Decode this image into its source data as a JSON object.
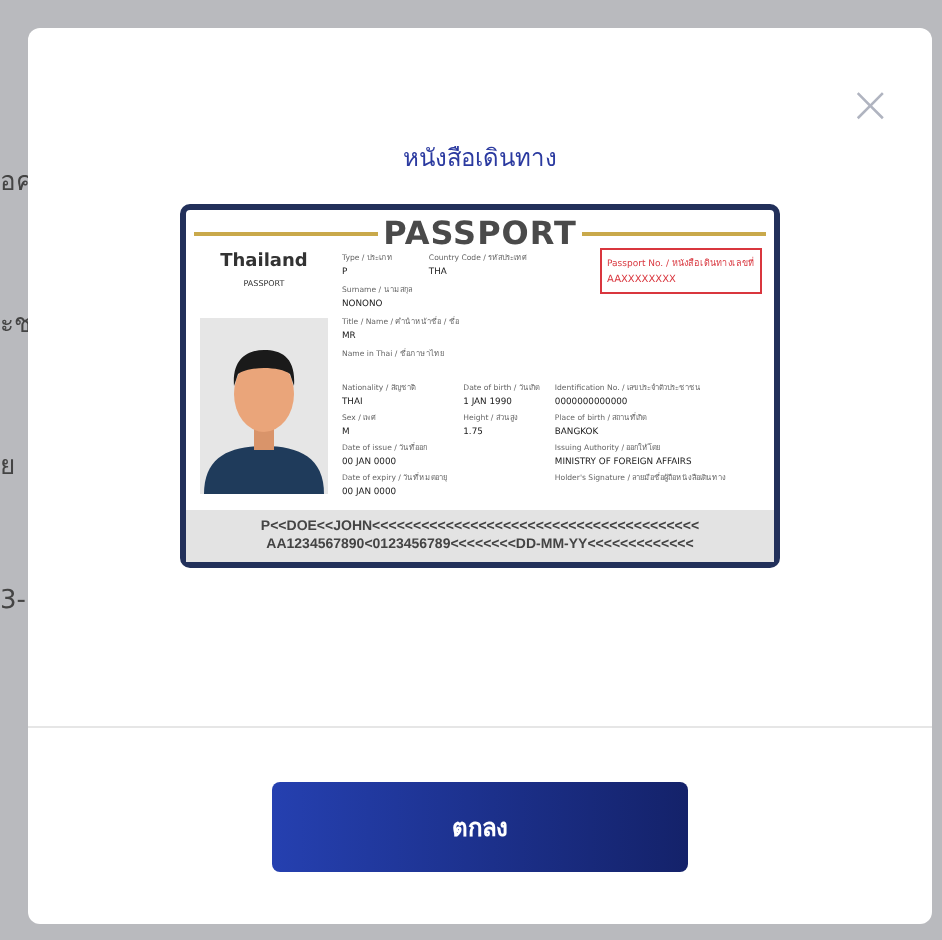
{
  "background": {
    "fragments": [
      "อค",
      "ะช",
      "ย",
      "3-"
    ]
  },
  "dialog": {
    "title": "หนังสือเดินทาง",
    "close": "×",
    "passport": {
      "heading": "PASSPORT",
      "country": "Thailand",
      "subheading": "PASSPORT",
      "number_label": "Passport No. / หนังสือเดินทางเลขที่",
      "number": "AAXXXXXXXX",
      "top_fields": [
        [
          {
            "label": "Type / ประเภท",
            "value": "P"
          },
          {
            "label": "Country Code / รหัสประเทศ",
            "value": "THA"
          }
        ],
        [
          {
            "label": "Surname / นามสกุล",
            "value": "NONONO"
          }
        ],
        [
          {
            "label": "Title / Name / คำนำหน้าชื่อ / ชื่อ",
            "value": "MR"
          }
        ],
        [
          {
            "label": "Name in Thai / ชื่อภาษาไทย"
          }
        ]
      ],
      "columns": [
        [
          {
            "label": "Nationality / สัญชาติ",
            "value": "THAI"
          },
          {
            "label": "Sex / เพศ",
            "value": "M"
          },
          {
            "label": "Date of issue / วันที่ออก",
            "value": "00 JAN 0000"
          },
          {
            "label": "Date of expiry / วันที่หมดอายุ",
            "value": "00 JAN 0000"
          }
        ],
        [
          {
            "label": "Date of birth / วันเกิด",
            "value": "1 JAN 1990"
          },
          {
            "label": "Height / ส่วนสูง",
            "value": "1.75"
          }
        ],
        [
          {
            "label": "Identification No. / เลขประจำตัวประชาชน",
            "value": "0000000000000"
          },
          {
            "label": "Place of birth / สถานที่เกิด",
            "value": "BANGKOK"
          },
          {
            "label": "Issuing Authority / ออกให้โดย",
            "value": "MINISTRY OF FOREIGN AFFAIRS"
          },
          {
            "label": "Holder's Signature / ลายมือชื่อผู้ถือหนังสือเดินทาง"
          }
        ]
      ],
      "mrz": [
        "P<<DOE<<JOHN<<<<<<<<<<<<<<<<<<<<<<<<<<<<<<<<<<<<<<<<",
        "AA1234567890<0123456789<<<<<<<<DD-MM-YY<<<<<<<<<<<<<"
      ]
    },
    "button": "ตกลง"
  }
}
